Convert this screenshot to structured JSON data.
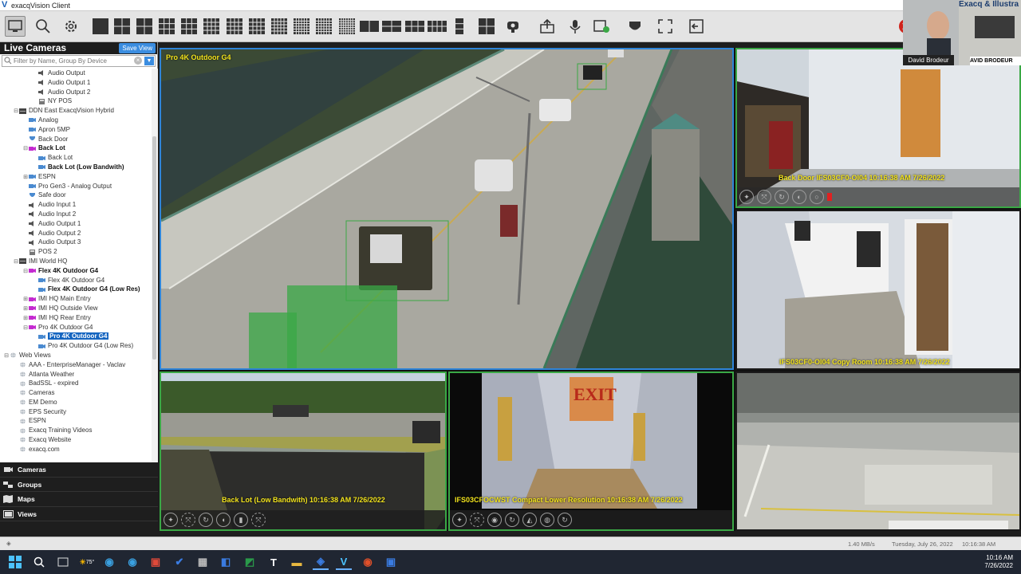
{
  "window": {
    "title": "exacqVision Client"
  },
  "toolbar": {
    "icons": [
      "monitor-icon",
      "search-icon",
      "gear-icon",
      "layout-1x1",
      "layout-2x2",
      "layout-2x2-b",
      "layout-1-5",
      "layout-3x3",
      "layout-1-7",
      "layout-4x4",
      "layout-1-12",
      "layout-5x5",
      "layout-6x6",
      "layout-7x7",
      "layout-8x8",
      "layout-wide-2",
      "layout-wide-4",
      "layout-wide-6",
      "layout-wide-8",
      "layout-tall",
      "layout-quad-menu",
      "camera-joystick-icon",
      "export-icon",
      "microphone-icon",
      "alarm-icon",
      "shield-icon",
      "fullscreen-icon",
      "exit-panel-icon",
      "close-icon"
    ]
  },
  "sidebar": {
    "title": "Live Cameras",
    "save_view": "Save View",
    "filter_placeholder": "Filter by Name, Group By Device",
    "tree": [
      {
        "label": "Audio Output",
        "indent": 3,
        "icon": "speaker"
      },
      {
        "label": "Audio Output 1",
        "indent": 3,
        "icon": "speaker"
      },
      {
        "label": "Audio Output 2",
        "indent": 3,
        "icon": "speaker"
      },
      {
        "label": "NY POS",
        "indent": 3,
        "icon": "pos"
      },
      {
        "label": "DDN East ExacqVision Hybrid",
        "indent": 1,
        "icon": "server",
        "exp": "−"
      },
      {
        "label": "Analog",
        "indent": 2,
        "icon": "camera"
      },
      {
        "label": "Apron 5MP",
        "indent": 2,
        "icon": "camera"
      },
      {
        "label": "Back Door",
        "indent": 2,
        "icon": "dome"
      },
      {
        "label": "Back Lot",
        "indent": 2,
        "icon": "magenta",
        "exp": "−",
        "bold": true
      },
      {
        "label": "Back Lot",
        "indent": 3,
        "icon": "camera"
      },
      {
        "label": "Back Lot (Low Bandwith)",
        "indent": 3,
        "icon": "camera",
        "bold": true
      },
      {
        "label": "ESPN",
        "indent": 2,
        "icon": "camera",
        "exp": "+"
      },
      {
        "label": "Pro Gen3 - Analog Output",
        "indent": 2,
        "icon": "camera"
      },
      {
        "label": "Safe door",
        "indent": 2,
        "icon": "dome"
      },
      {
        "label": "Audio Input 1",
        "indent": 2,
        "icon": "speaker"
      },
      {
        "label": "Audio Input 2",
        "indent": 2,
        "icon": "speaker"
      },
      {
        "label": "Audio Output 1",
        "indent": 2,
        "icon": "speaker"
      },
      {
        "label": "Audio Output 2",
        "indent": 2,
        "icon": "speaker"
      },
      {
        "label": "Audio Output 3",
        "indent": 2,
        "icon": "speaker"
      },
      {
        "label": "POS 2",
        "indent": 2,
        "icon": "pos"
      },
      {
        "label": "IMI World HQ",
        "indent": 1,
        "icon": "server",
        "exp": "−"
      },
      {
        "label": "Flex 4K Outdoor G4",
        "indent": 2,
        "icon": "magenta",
        "exp": "−",
        "bold": true
      },
      {
        "label": "Flex 4K Outdoor G4",
        "indent": 3,
        "icon": "camera"
      },
      {
        "label": "Flex 4K Outdoor G4 (Low Res)",
        "indent": 3,
        "icon": "camera",
        "bold": true
      },
      {
        "label": "IMI HQ Main Entry",
        "indent": 2,
        "icon": "magenta",
        "exp": "+"
      },
      {
        "label": "IMI HQ Outside View",
        "indent": 2,
        "icon": "magenta",
        "exp": "+"
      },
      {
        "label": "IMI HQ Rear Entry",
        "indent": 2,
        "icon": "magenta",
        "exp": "+"
      },
      {
        "label": "Pro 4K Outdoor G4",
        "indent": 2,
        "icon": "magenta",
        "exp": "−"
      },
      {
        "label": "Pro 4K Outdoor G4",
        "indent": 3,
        "icon": "camera",
        "selected": true
      },
      {
        "label": "Pro 4K Outdoor G4 (Low Res)",
        "indent": 3,
        "icon": "camera"
      },
      {
        "label": "Web Views",
        "indent": 0,
        "icon": "globe",
        "exp": "−"
      },
      {
        "label": "AAA - EnterpriseManager - Vaclav",
        "indent": 1,
        "icon": "globe"
      },
      {
        "label": "Atlanta Weather",
        "indent": 1,
        "icon": "globe"
      },
      {
        "label": "BadSSL - expired",
        "indent": 1,
        "icon": "globe"
      },
      {
        "label": "Cameras",
        "indent": 1,
        "icon": "globe"
      },
      {
        "label": "EM Demo",
        "indent": 1,
        "icon": "globe"
      },
      {
        "label": "EPS Security",
        "indent": 1,
        "icon": "globe"
      },
      {
        "label": "ESPN",
        "indent": 1,
        "icon": "globe"
      },
      {
        "label": "Exacq Training Videos",
        "indent": 1,
        "icon": "globe"
      },
      {
        "label": "Exacq Website",
        "indent": 1,
        "icon": "globe"
      },
      {
        "label": "exacq.com",
        "indent": 1,
        "icon": "globe"
      }
    ],
    "nav": [
      "Cameras",
      "Groups",
      "Maps",
      "Views"
    ]
  },
  "panes": {
    "main": {
      "label": "Pro 4K Outdoor G4"
    },
    "top_right": {
      "label": "Back Door IFS03CF0-OI04 10:16:38 AM 7/26/2022"
    },
    "mid_right": {
      "label": "IFS03CF0-OI04 Copy Room 10:16:38 AM 7/26/2022"
    },
    "bottom_left": {
      "label": "Back Lot (Low Bandwith) 10:16:38 AM 7/26/2022"
    },
    "bottom_mid": {
      "label": "IFS03CFOCWST Compact Lower Resolution 10:16:38 AM 7/26/2022",
      "exit": "EXIT"
    }
  },
  "status": {
    "bandwidth": "1.40 MB/s",
    "date": "Tuesday, July 26, 2022",
    "time": "10:16:38 AM"
  },
  "taskbar": {
    "temp": "75°",
    "time": "10:16 AM",
    "date": "7/26/2022",
    "text_app": "T"
  },
  "webcam": {
    "name": "David Brodeur",
    "brand": "Exacq  &  Illustra",
    "brand2": "AVID BRODEUR"
  },
  "colors": {
    "accent": "#2e84d8",
    "pane_border": "#3aa845",
    "overlay_text": "#f2e31d",
    "detect_box": "#3aa845"
  }
}
